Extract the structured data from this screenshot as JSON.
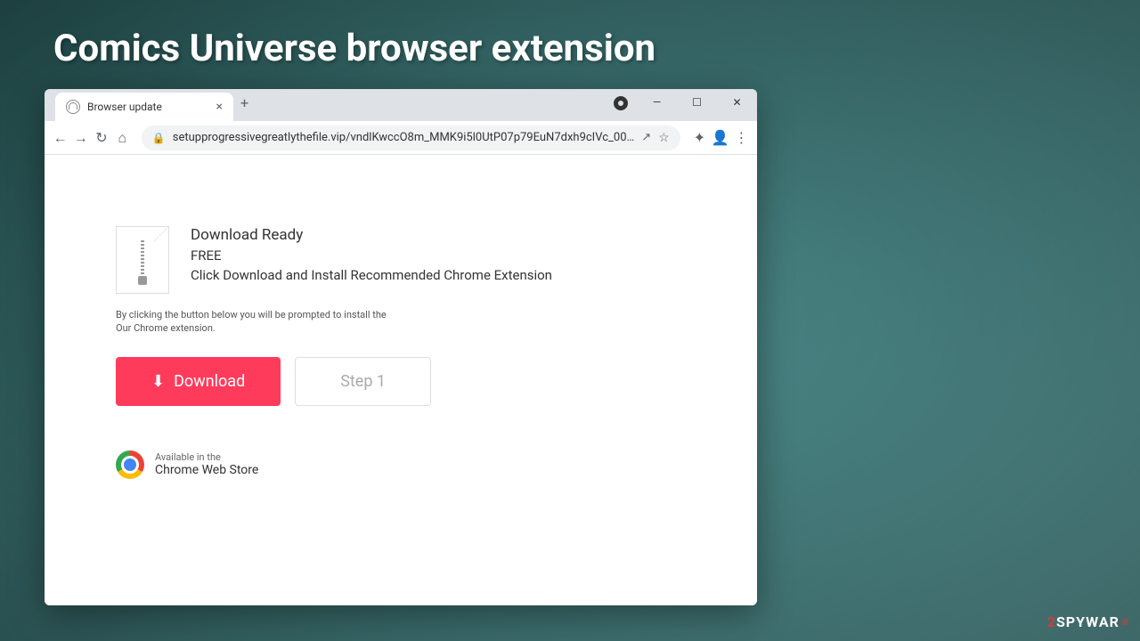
{
  "header": {
    "title": "Comics Universe browser extension"
  },
  "browser": {
    "tab": {
      "title": "Browser update",
      "close": "×",
      "new_tab": "+"
    },
    "window_controls": {
      "minimize": "—",
      "maximize": "☐",
      "close": "✕"
    },
    "toolbar": {
      "back": "←",
      "forward": "→",
      "reload": "↻",
      "home": "⌂",
      "lock": "🔒",
      "url": "setupprogressivegreatlythefile.vip/vndlKwccO8m_MMK9i5l0UtP07p79EuN7dxh9cIVc_00…",
      "share": "↗",
      "star": "☆",
      "extensions": "✦",
      "profile": "👤",
      "menu": "⋮"
    }
  },
  "page": {
    "download_ready": "Download Ready",
    "free": "FREE",
    "instruction": "Click Download and Install Recommended Chrome Extension",
    "disclaimer_line1": "By clicking the button below you will be prompted to install the",
    "disclaimer_line2": "Our Chrome extension.",
    "download_btn": "Download",
    "download_icon": "⬇",
    "step_btn": "Step 1",
    "webstore_prefix": "Available in the",
    "webstore_name": "Chrome Web Store"
  },
  "watermark": {
    "prefix": "2",
    "brand": "SPYWAR",
    "suffix": "≡"
  }
}
